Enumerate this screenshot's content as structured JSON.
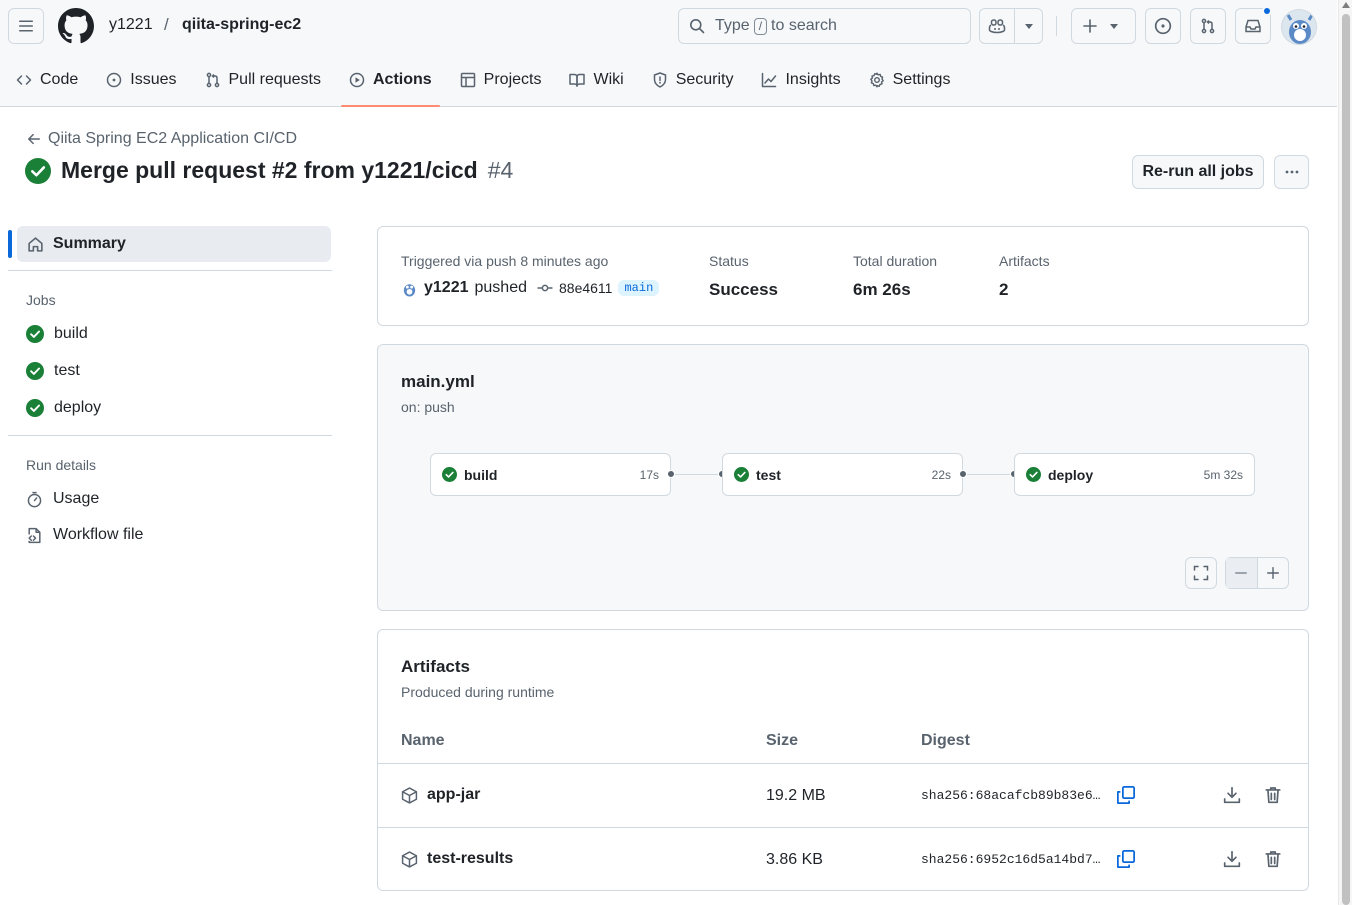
{
  "repo": {
    "owner": "y1221",
    "separator": "/",
    "name": "qiita-spring-ec2"
  },
  "search": {
    "prefix": "Type",
    "key": "/",
    "suffix": "to search"
  },
  "nav": [
    {
      "label": "Code",
      "icon": "code-icon"
    },
    {
      "label": "Issues",
      "icon": "issue-icon"
    },
    {
      "label": "Pull requests",
      "icon": "pull-request-icon"
    },
    {
      "label": "Actions",
      "icon": "play-icon",
      "active": true
    },
    {
      "label": "Projects",
      "icon": "table-icon"
    },
    {
      "label": "Wiki",
      "icon": "book-icon"
    },
    {
      "label": "Security",
      "icon": "shield-icon"
    },
    {
      "label": "Insights",
      "icon": "graph-icon"
    },
    {
      "label": "Settings",
      "icon": "gear-icon"
    }
  ],
  "run": {
    "workflow_name": "Qiita Spring EC2 Application CI/CD",
    "title": "Merge pull request #2 from y1221/cicd",
    "number": "#4",
    "rerun_label": "Re-run all jobs"
  },
  "sidebar": {
    "summary": "Summary",
    "jobs_heading": "Jobs",
    "jobs": [
      "build",
      "test",
      "deploy"
    ],
    "details_heading": "Run details",
    "usage": "Usage",
    "workflow_file": "Workflow file"
  },
  "summary": {
    "triggered": "Triggered via push 8 minutes ago",
    "user": "y1221",
    "action": "pushed",
    "sha": "88e4611",
    "branch": "main",
    "status_label": "Status",
    "status": "Success",
    "duration_label": "Total duration",
    "duration": "6m 26s",
    "artifacts_label": "Artifacts",
    "artifacts_count": "2"
  },
  "graph": {
    "file": "main.yml",
    "trigger": "on: push",
    "jobs": [
      {
        "name": "build",
        "duration": "17s"
      },
      {
        "name": "test",
        "duration": "22s"
      },
      {
        "name": "deploy",
        "duration": "5m 32s"
      }
    ]
  },
  "artifacts": {
    "title": "Artifacts",
    "subtitle": "Produced during runtime",
    "columns": [
      "Name",
      "Size",
      "Digest"
    ],
    "rows": [
      {
        "name": "app-jar",
        "size": "19.2 MB",
        "digest": "sha256:68acafcb89b83e635…"
      },
      {
        "name": "test-results",
        "size": "3.86 KB",
        "digest": "sha256:6952c16d5a14bd71b…"
      }
    ]
  },
  "colors": {
    "success": "#1a7f37",
    "accent": "#0969da",
    "nav_underline": "#fd8c73"
  }
}
